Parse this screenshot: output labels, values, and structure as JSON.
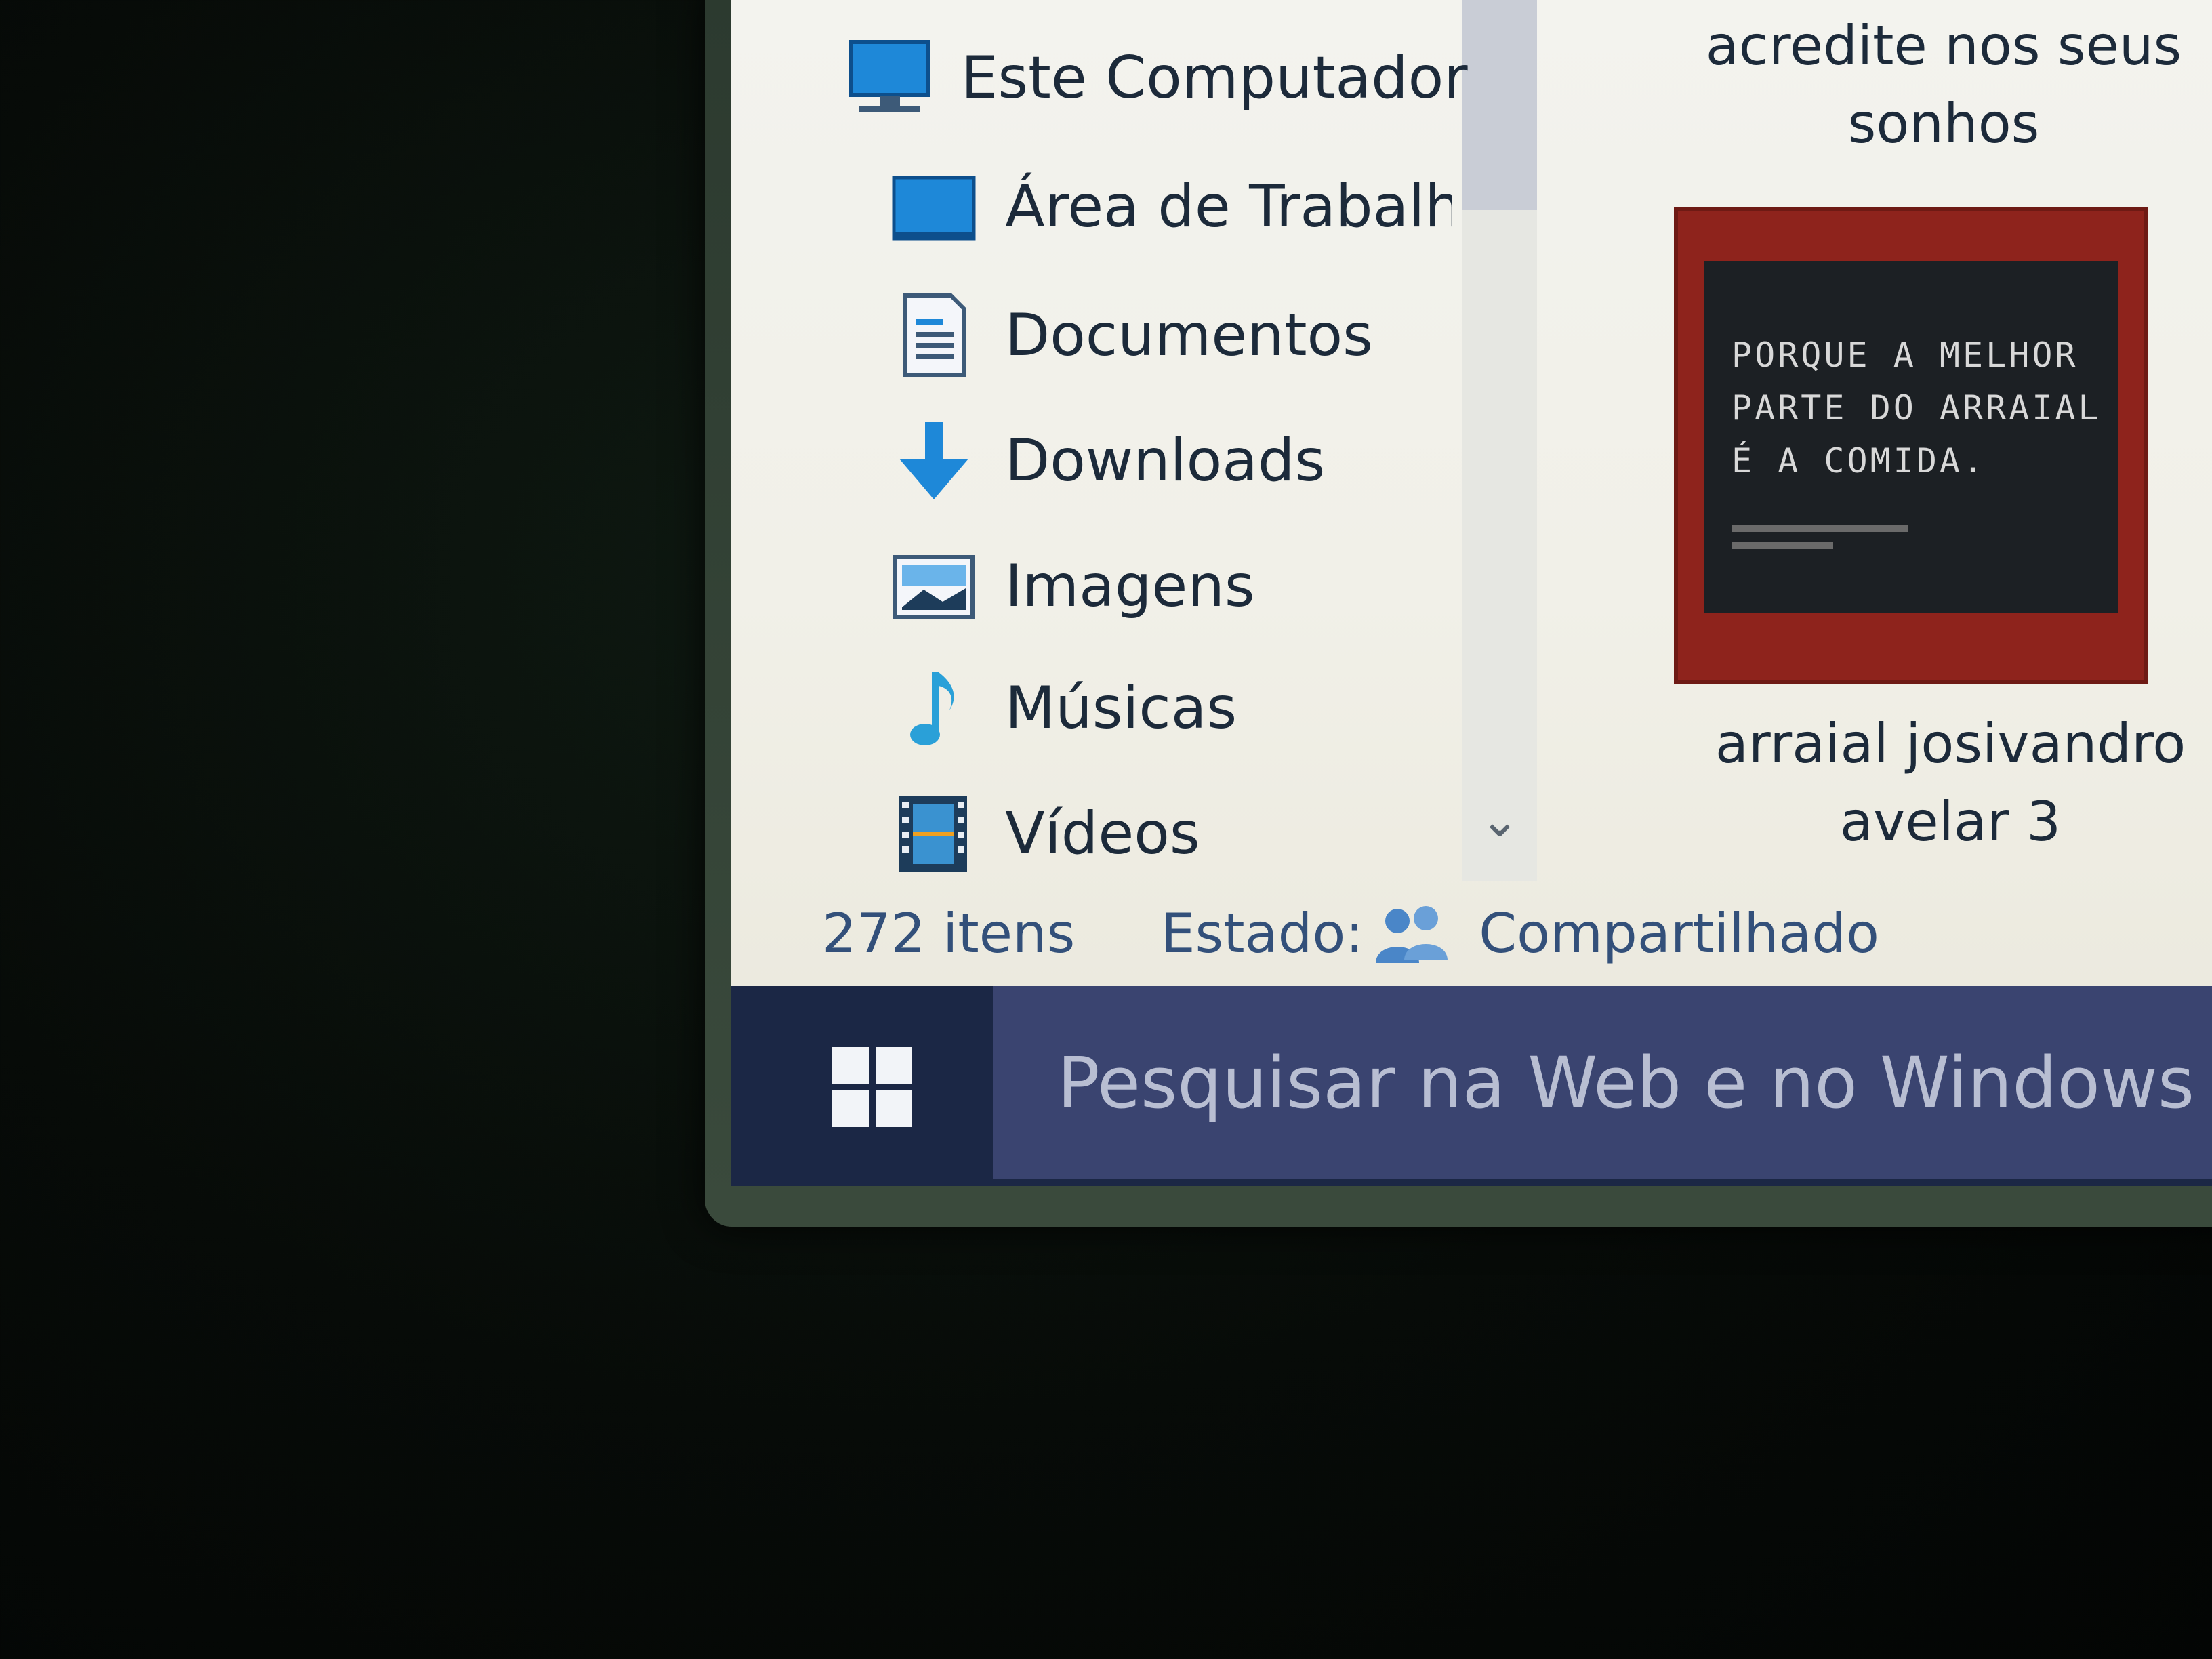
{
  "nav": {
    "items": [
      {
        "label": "Este Computador",
        "icon": "computer-icon"
      },
      {
        "label": "Área de Trabalho",
        "icon": "desktop-icon"
      },
      {
        "label": "Documentos",
        "icon": "documents-icon"
      },
      {
        "label": "Downloads",
        "icon": "download-arrow-icon"
      },
      {
        "label": "Imagens",
        "icon": "pictures-icon"
      },
      {
        "label": "Músicas",
        "icon": "music-note-icon"
      },
      {
        "label": "Vídeos",
        "icon": "videos-icon"
      }
    ]
  },
  "content": {
    "files": [
      {
        "name_line1": "acredite nos seus",
        "name_line2": "sonhos"
      },
      {
        "name_line1": "arraial josivandro",
        "name_line2": "avelar 3",
        "thumbnail_text": [
          "PORQUE A MELHOR",
          "PARTE DO ARRAIAL",
          "É A COMIDA."
        ]
      }
    ]
  },
  "status": {
    "item_count": "272 itens",
    "state_label": "Estado:",
    "state_value": "Compartilhado",
    "state_icon": "shared-users-icon"
  },
  "taskbar": {
    "start_icon": "windows-logo-icon",
    "search_placeholder": "Pesquisar na Web e no Windows"
  },
  "colors": {
    "taskbar": "#1b2745",
    "search_box": "#3a4470",
    "accent_icon": "#1e88d8",
    "thumbnail_frame": "#8e231c"
  }
}
